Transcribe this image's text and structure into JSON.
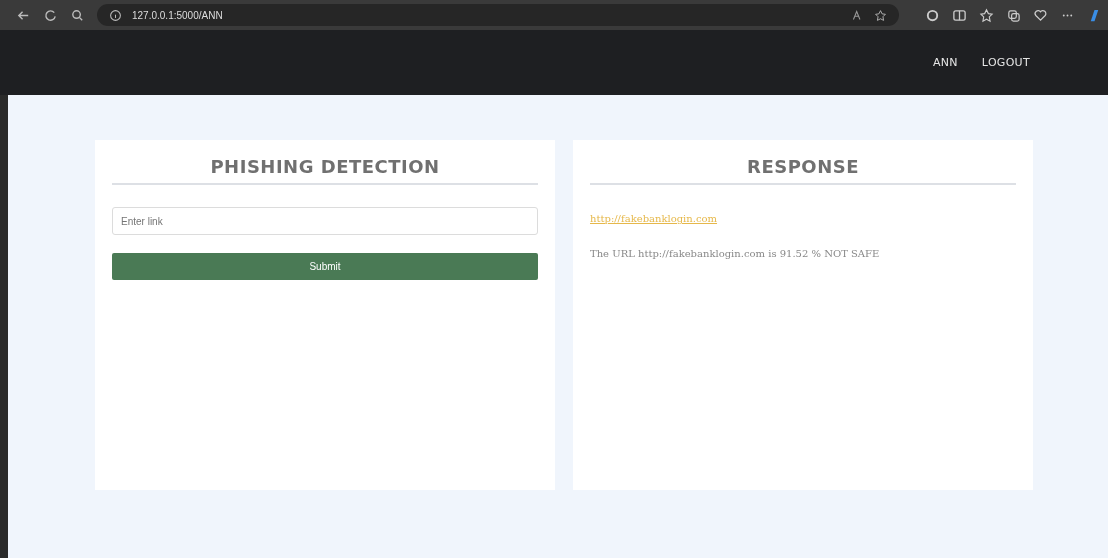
{
  "browser": {
    "address": "127.0.0.1:5000/ANN"
  },
  "nav": {
    "items": [
      "ANN",
      "LOGOUT"
    ]
  },
  "detection": {
    "title": "PHISHING DETECTION",
    "input": {
      "placeholder": "Enter link"
    },
    "button": "Submit"
  },
  "response": {
    "title": "RESPONSE",
    "link": "http://fakebanklogin.com",
    "message": "The URL http://fakebanklogin.com is 91.52 % NOT SAFE"
  }
}
